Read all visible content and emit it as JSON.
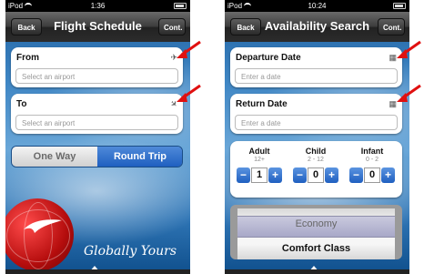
{
  "left_screen": {
    "status": {
      "carrier": "iPod",
      "time": "1:36"
    },
    "nav": {
      "back_label": "Back",
      "title": "Flight Schedule",
      "cont_label": "Cont."
    },
    "from": {
      "label": "From",
      "placeholder": "Select an airport",
      "icon": "plane-departure-icon"
    },
    "to": {
      "label": "To",
      "placeholder": "Select an airport",
      "icon": "plane-arrival-icon"
    },
    "trip_type": {
      "one_way": "One Way",
      "round_trip": "Round Trip",
      "selected": "Round Trip"
    },
    "tagline": "Globally Yours"
  },
  "right_screen": {
    "status": {
      "carrier": "iPod",
      "time": "10:24"
    },
    "nav": {
      "back_label": "Back",
      "title": "Availability Search",
      "cont_label": "Cont."
    },
    "departure": {
      "label": "Departure Date",
      "placeholder": "Enter a date",
      "icon": "calendar-icon"
    },
    "return": {
      "label": "Return Date",
      "placeholder": "Enter a date",
      "icon": "calendar-icon"
    },
    "passengers": [
      {
        "label": "Adult",
        "range": "12+",
        "value": "1"
      },
      {
        "label": "Child",
        "range": "2 - 12",
        "value": "0"
      },
      {
        "label": "Infant",
        "range": "0 - 2",
        "value": "0"
      }
    ],
    "cabin_picker": {
      "options": [
        "Economy",
        "Comfort Class"
      ]
    }
  },
  "colors": {
    "annotation_arrow": "#e01010",
    "accent_blue": "#1f5fc0",
    "brand_red": "#c8102e"
  }
}
